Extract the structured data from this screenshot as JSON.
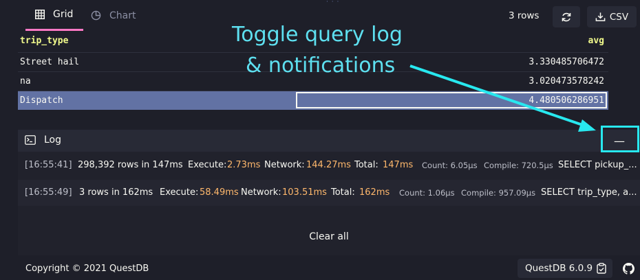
{
  "tabs": [
    {
      "label": "Grid",
      "icon": "grid-icon",
      "active": true
    },
    {
      "label": "Chart",
      "icon": "chart-icon",
      "active": false
    }
  ],
  "toolbar": {
    "rows_count": "3 rows",
    "refresh_icon": "refresh-icon",
    "csv_label": "CSV"
  },
  "grid": {
    "columns": [
      "trip_type",
      "avg"
    ],
    "rows": [
      [
        "Street hail",
        "3.330485706472"
      ],
      [
        "na",
        "3.020473578242"
      ],
      [
        "Dispatch",
        "4.480506286951"
      ]
    ],
    "selected_row": 2
  },
  "log": {
    "title": "Log",
    "toggle_label": "—",
    "entries": [
      {
        "time": "[16:55:41]",
        "summary": "298,392 rows in 147ms",
        "execute_label": "Execute:",
        "execute_value": "2.73ms",
        "network_label": "Network:",
        "network_value": "144.27ms",
        "total_label": "Total:",
        "total_value": "147ms",
        "count": "Count: 6.05µs",
        "compile": "Compile: 720.5µs",
        "query": "SELECT pickup_..."
      },
      {
        "time": "[16:55:49]",
        "summary": "3 rows in 162ms",
        "execute_label": "Execute:",
        "execute_value": "58.49ms",
        "network_label": "Network:",
        "network_value": "103.51ms",
        "total_label": "Total:",
        "total_value": "162ms",
        "count": "Count: 1.06µs",
        "compile": "Compile: 957.09µs",
        "query": "SELECT trip_type, a..."
      }
    ],
    "clear_all": "Clear all"
  },
  "footer": {
    "copyright": "Copyright © 2021 QuestDB",
    "version": "QuestDB 6.0.9"
  },
  "annotation": {
    "line1": "Toggle query log",
    "line2": "& notifications",
    "color": "#28e8ef"
  }
}
